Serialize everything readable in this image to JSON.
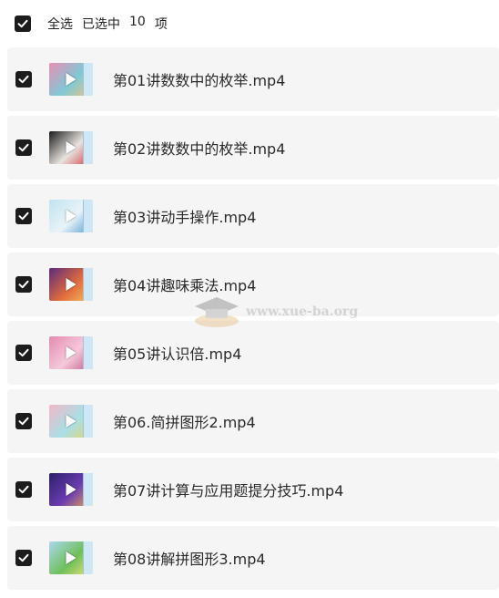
{
  "header": {
    "select_all_label": "全选",
    "selected_prefix": "已选中",
    "selected_count": "10",
    "selected_suffix": "项"
  },
  "files": [
    {
      "name": "第01讲数数中的枚举.mp4",
      "thumb_colors": [
        "#e98fb3",
        "#7fc9d6",
        "#f3c27a"
      ]
    },
    {
      "name": "第02讲数数中的枚举.mp4",
      "thumb_colors": [
        "#1a1a1a",
        "#e8e4e0",
        "#d43b3b"
      ]
    },
    {
      "name": "第03讲动手操作.mp4",
      "thumb_colors": [
        "#bfe3f0",
        "#e9f3f8",
        "#4d9ad0"
      ]
    },
    {
      "name": "第04讲趣味乘法.mp4",
      "thumb_colors": [
        "#5a2b7a",
        "#e26b3c",
        "#f2c65b"
      ]
    },
    {
      "name": "第05讲认识倍.mp4",
      "thumb_colors": [
        "#e48ab0",
        "#f5c9da",
        "#c25a8a"
      ]
    },
    {
      "name": "第06.简拼图形2.mp4",
      "thumb_colors": [
        "#f2b8c6",
        "#a9dfe6",
        "#e8d36b"
      ]
    },
    {
      "name": "第07讲计算与应用题提分技巧.mp4",
      "thumb_colors": [
        "#2d1e6b",
        "#6a3db0",
        "#f0a94a"
      ]
    },
    {
      "name": "第08讲解拼图形3.mp4",
      "thumb_colors": [
        "#a9d9ef",
        "#6fbf5a",
        "#f3e27a"
      ]
    }
  ],
  "watermark": {
    "text": "www.xue-ba.org"
  },
  "colors": {
    "checkbox": "#1c1c1c",
    "row_bg": "#f5f5f6"
  }
}
